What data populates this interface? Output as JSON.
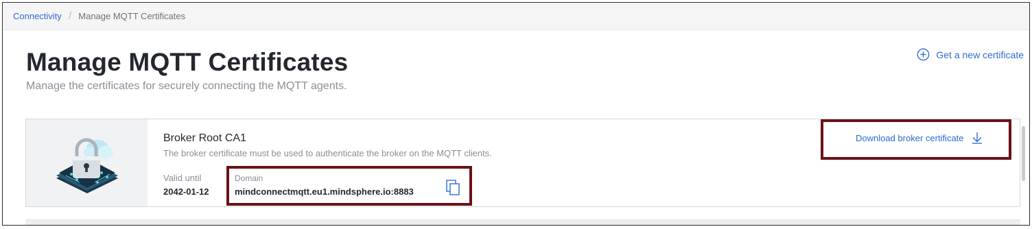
{
  "breadcrumb": {
    "parent": "Connectivity",
    "separator": "/",
    "current": "Manage MQTT Certificates"
  },
  "header": {
    "title": "Manage MQTT Certificates",
    "subtitle": "Manage the certificates for securely connecting the MQTT agents.",
    "new_certificate_label": "Get a new certificate",
    "new_certificate_icon": "plus-circle-icon"
  },
  "certificate": {
    "name": "Broker Root CA1",
    "description": "The broker certificate must be used to authenticate the broker on the MQTT clients.",
    "valid_until_label": "Valid until",
    "valid_until_value": "2042-01-12",
    "domain_label": "Domain",
    "domain_value": "mindconnectmqtt.eu1.mindsphere.io:8883",
    "copy_icon": "copy-icon",
    "download_label": "Download broker certificate",
    "download_icon": "download-icon",
    "illustration_icon": "padlock-cloud-icon"
  },
  "colors": {
    "link": "#2d6bd1",
    "highlight_border": "#6b1118",
    "title": "#24282e",
    "muted": "#8a8e95"
  }
}
